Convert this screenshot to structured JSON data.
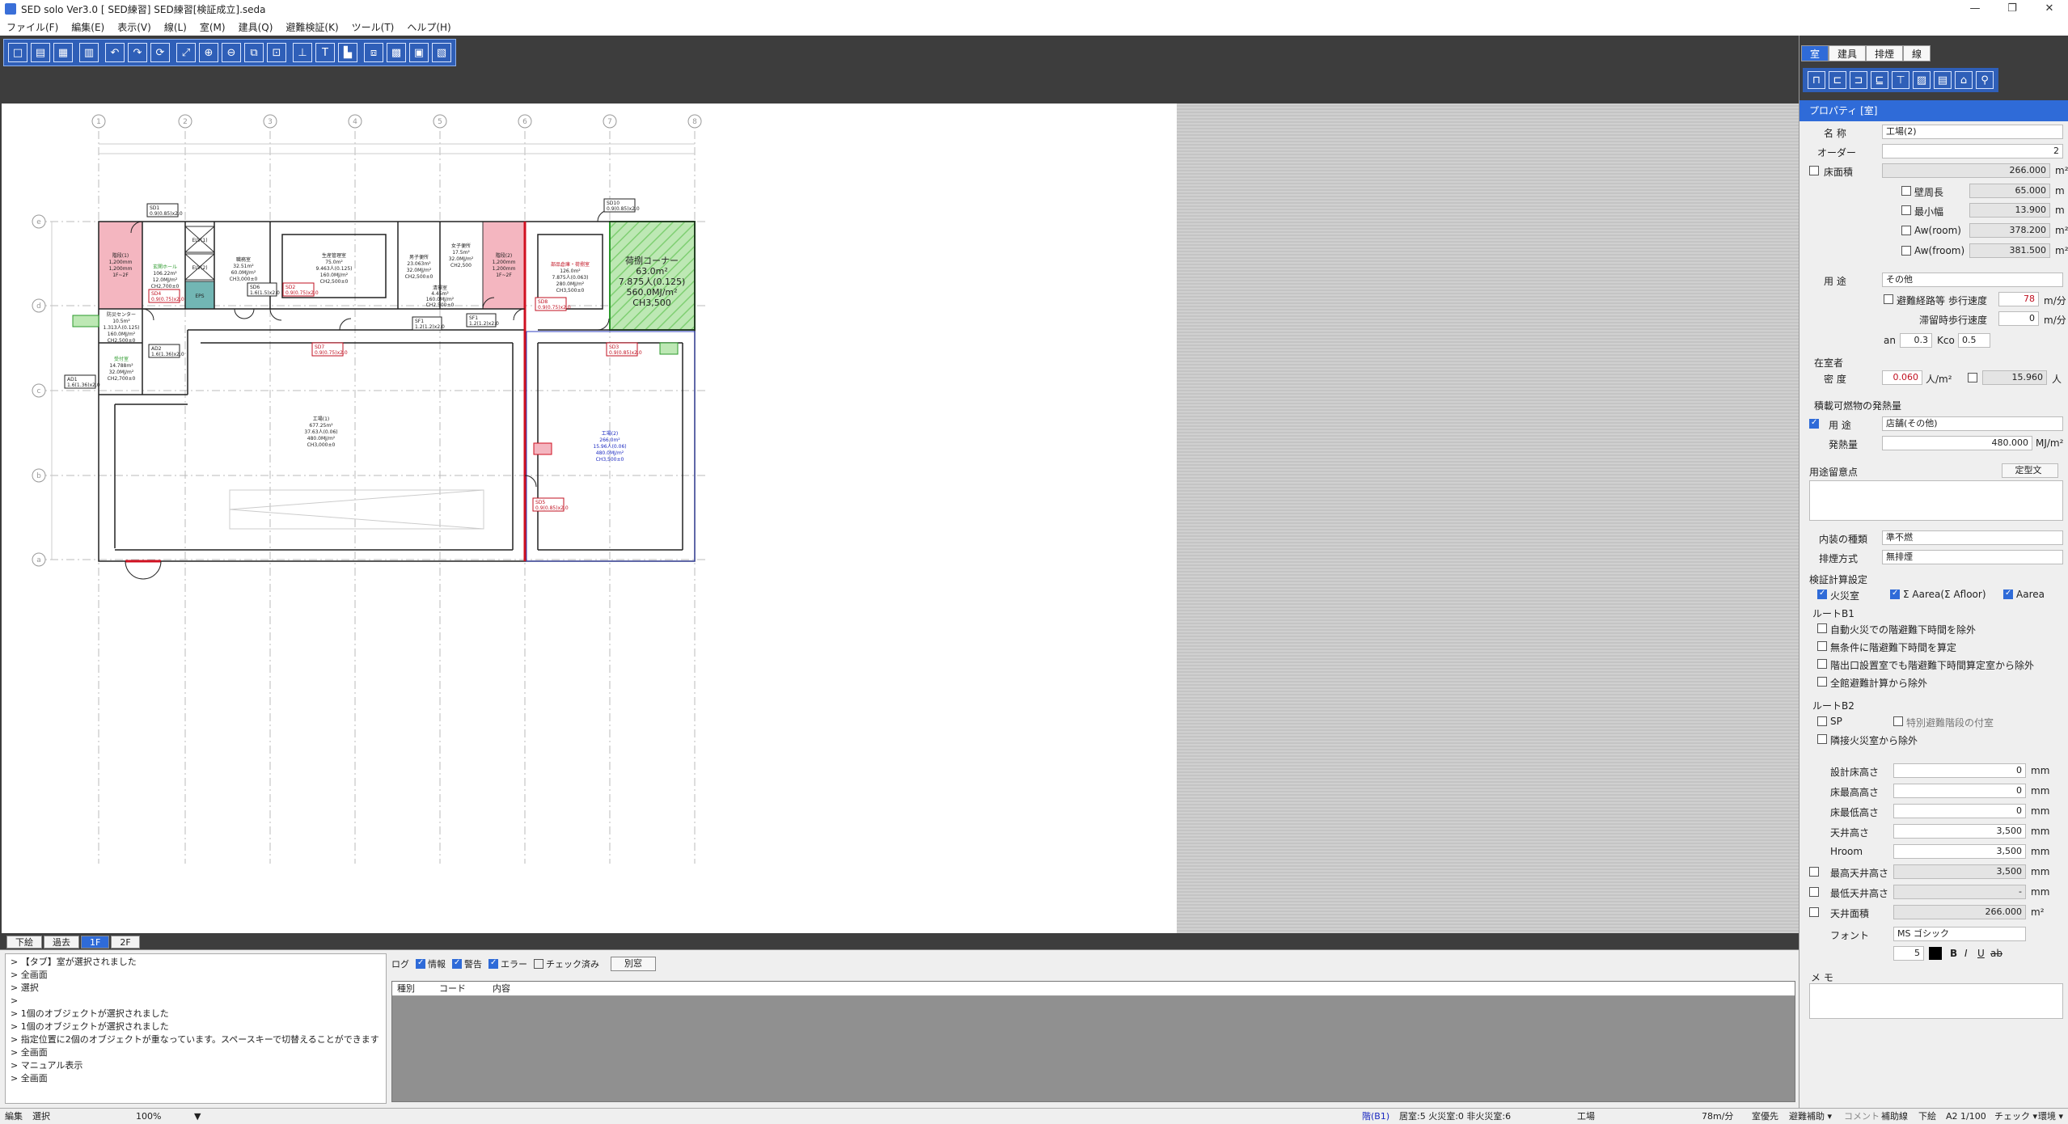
{
  "window": {
    "title": "SED solo Ver3.0 [ SED練習] SED練習[検証成立].seda",
    "controls": [
      "—",
      "❐",
      "✕"
    ]
  },
  "menu": [
    "ファイル(F)",
    "編集(E)",
    "表示(V)",
    "線(L)",
    "室(M)",
    "建具(Q)",
    "避難検証(K)",
    "ツール(T)",
    "ヘルプ(H)"
  ],
  "right_tabs": [
    "室",
    "建具",
    "排煙",
    "線"
  ],
  "panel": {
    "header": "プロパティ [室]",
    "name_label": "名 称",
    "name_value": "工場(2)",
    "order_label": "オーダー",
    "order_value": "2",
    "floor_area_label": "床面積",
    "floor_area_value": "266.000",
    "m2": "m²",
    "wall_len_label": "壁周長",
    "wall_len_value": "65.000",
    "min_width_label": "最小幅",
    "min_width_value": "13.900",
    "aw_room_label": "Aw(room)",
    "aw_room_value": "378.200",
    "aw_froom_label": "Aw(froom)",
    "aw_froom_value": "381.500",
    "m": "m",
    "use_label": "用 途",
    "use_value": "その他",
    "evac_route_label": "避難経路等",
    "walk_speed_label": "歩行速度",
    "walk_speed_value": "78",
    "mpm": "m/分",
    "stay_speed_label": "滞留時歩行速度",
    "stay_speed_value": "0",
    "an_label": "an",
    "an_value": "0.3",
    "kco_label": "Kco",
    "kco_value": "0.5",
    "occupants_section": "在室者",
    "density_label": "密 度",
    "density_value": "0.060",
    "density_unit": "人/m²",
    "persons_value": "15.960",
    "persons_unit": "人",
    "fire_load_section": "積載可燃物の発熱量",
    "fire_use_label": "用 途",
    "fire_use_value": "店舗(その他)",
    "heat_label": "発熱量",
    "heat_value": "480.000",
    "heat_unit": "MJ/m²",
    "notes_label": "用途留意点",
    "template_button": "定型文",
    "finish_label": "内装の種類",
    "finish_value": "準不燃",
    "smoke_label": "排煙方式",
    "smoke_value": "無排煙",
    "calc_section": "検証計算設定",
    "fire_room_label": "火災室",
    "sum_area_label": "Σ Aarea(Σ Afloor)",
    "aarea_label": "Aarea",
    "route_b1": "ルートB1",
    "b1_opt1": "自動火災での階避難下時間を除外",
    "b1_opt2": "無条件に階避難下時間を算定",
    "b1_opt3": "階出口設置室でも階避難下時間算定室から除外",
    "b1_opt4": "全館避難計算から除外",
    "route_b2": "ルートB2",
    "sp_label": "SP",
    "special_stair_label": "特別避難階段の付室",
    "b2_opt": "隣接火災室から除外",
    "design_fl_label": "設計床高さ",
    "design_fl_value": "0",
    "fl_max_label": "床最高高さ",
    "fl_max_value": "0",
    "fl_min_label": "床最低高さ",
    "fl_min_value": "0",
    "ceiling_label": "天井高さ",
    "ceiling_value": "3,500",
    "hroom_label": "Hroom",
    "hroom_value": "3,500",
    "ceil_max_label": "最高天井高さ",
    "ceil_max_value": "3,500",
    "ceil_min_label": "最低天井高さ",
    "ceil_min_value": "-",
    "ceil_area_label": "天井面積",
    "ceil_area_value": "266.000",
    "mm": "mm",
    "font_label": "フォント",
    "font_value": "MS ゴシック",
    "font_size": "5",
    "memo_label": "メ モ"
  },
  "floor_tabs": [
    "下絵",
    "過去",
    "1F",
    "2F"
  ],
  "log_lines": [
    "> 【タブ】室が選択されました",
    "> 全画面",
    "> 選択",
    ">",
    "> 1個のオブジェクトが選択されました",
    "> 1個のオブジェクトが選択されました",
    "> 指定位置に2個のオブジェクトが重なっています。スペースキーで切替えることができます",
    "> 全画面",
    "> マニュアル表示",
    "> 全画面"
  ],
  "log_toolbar": {
    "log_label": "ログ",
    "info": "情報",
    "warn": "警告",
    "error": "エラー",
    "checked": "チェック済み",
    "separate_button": "別窓"
  },
  "log_columns": [
    "種別",
    "コード",
    "内容"
  ],
  "status": {
    "mode": "編集",
    "tool": "選択",
    "zoom": "100%",
    "floor": "階(B1)",
    "counts": "居室:5 火災室:0 非火災室:6",
    "room": "工場",
    "speed": "78m/分",
    "items": [
      "室優先",
      "避難補助 ▾",
      "コメント",
      "補助線",
      "下絵",
      "A2 1/100",
      "チェック ▾",
      "環境 ▾"
    ]
  },
  "plan": {
    "axis_cols": [
      "1",
      "2",
      "3",
      "4",
      "5",
      "6",
      "7",
      "8"
    ],
    "axis_rows": [
      "e",
      "d",
      "c",
      "b",
      "a"
    ],
    "stair1": [
      "階段(1)",
      "1,200mm",
      "1,200mm",
      "1F~2F"
    ],
    "stair2": [
      "階段(2)",
      "1,200mm",
      "1,200mm",
      "1F~2F"
    ],
    "elv1": "ELV(1)",
    "elv2": "ELV(2)",
    "eps": "EPS",
    "hall": [
      "玄関ホール",
      "106.22m²",
      "12.0MJ/m²",
      "CH2,700±0"
    ],
    "office1": [
      "職務室",
      "32.51m²",
      "60.0MJ/m²",
      "CH3,000±0"
    ],
    "prod_mgmt": [
      "生産管理室",
      "75.0m²",
      "9.463人(0.125)",
      "160.0MJ/m²",
      "CH2,500±0"
    ],
    "male_wc": [
      "男子便所",
      "23.063m²",
      "32.0MJ/m²",
      "CH2,500±0"
    ],
    "female_wc": [
      "女子便所",
      "17.5m²",
      "32.0MJ/m²",
      "CH2,500"
    ],
    "cleaning": [
      "清掃室",
      "4.45m²",
      "160.0MJ/m²",
      "CH2,500±0"
    ],
    "parts_store": [
      "部品倉庫・荷捌室",
      "126.0m²",
      "7.875人(0.063)",
      "280.0MJ/m²",
      "CH3,500±0"
    ],
    "loading": [
      "荷捌コーナー",
      "63.0m²",
      "7.875人(0.125)",
      "560.0MJ/m²",
      "CH3,500"
    ],
    "disaster_center": [
      "防災センター",
      "10.5m²",
      "1.313人(0.125)",
      "160.0MJ/m²",
      "CH2,500±0"
    ],
    "reception": [
      "受付室",
      "14.788m²",
      "32.0MJ/m²",
      "CH2,700±0"
    ],
    "factory1": [
      "工場(1)",
      "677.25m²",
      "37.63人(0.06)",
      "480.0MJ/m²",
      "CH3,000±0"
    ],
    "factory2": [
      "工場(2)",
      "266.0m²",
      "15.96人(0.06)",
      "480.0MJ/m²",
      "CH3,500±0"
    ],
    "doors": {
      "sd1": "SD1",
      "sd1v": "0.9(0.85)x2.0",
      "sd10": "SD10",
      "sd10v": "0.9(0.85)x2.0",
      "sd4": "SD4",
      "sd4v": "0.9(0.75)x2.0",
      "sd6": "SD6",
      "sd6v": "1.6(1.5)x2.0",
      "sd2": "SD2",
      "sd2v": "0.9(0.75)x2.0",
      "sd8": "SD8",
      "sd8v": "0.9(0.75)x2.0",
      "sd7": "SD7",
      "sd7v": "0.9(0.75)x2.0",
      "sd3": "SD3",
      "sd3v": "0.9(0.85)x2.0",
      "sd5": "SD5",
      "sd5v": "0.9(0.85)x2.0",
      "ad2": "AD2",
      "ad2v": "1.6(1.36)x2.0",
      "ad1": "AD1",
      "ad1v": "1.6(1.36)x2.0",
      "sf1": "SF1",
      "sf1v": "1.2(1.2)x2.0",
      "sf2": "SF1",
      "sf2v": "1.2(1.2)x2.0"
    }
  }
}
